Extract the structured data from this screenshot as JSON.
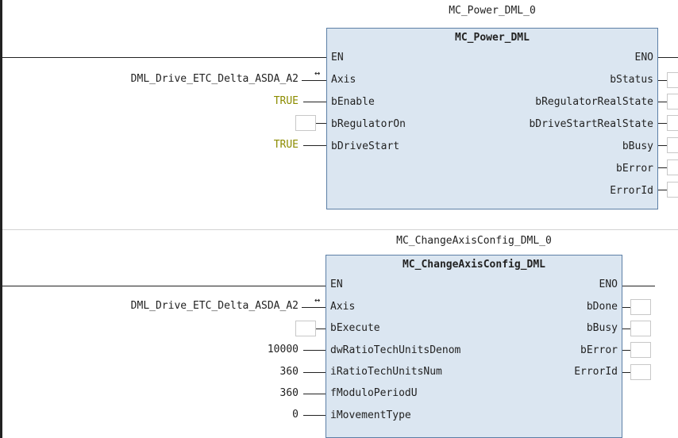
{
  "network1": {
    "instance": "MC_Power_DML_0",
    "type": "MC_Power_DML",
    "inputs": [
      "EN",
      "Axis",
      "bEnable",
      "bRegulatorOn",
      "bDriveStart"
    ],
    "outputs": [
      "ENO",
      "bStatus",
      "bRegulatorRealState",
      "bDriveStartRealState",
      "bBusy",
      "bError",
      "ErrorId"
    ],
    "axis_var": "DML_Drive_ETC_Delta_ASDA_A2",
    "enable_value": "TRUE",
    "drivestart_value": "TRUE"
  },
  "network2": {
    "instance": "MC_ChangeAxisConfig_DML_0",
    "type": "MC_ChangeAxisConfig_DML",
    "inputs": [
      "EN",
      "Axis",
      "bExecute",
      "dwRatioTechUnitsDenom",
      "iRatioTechUnitsNum",
      "fModuloPeriodU",
      "iMovementType"
    ],
    "outputs": [
      "ENO",
      "bDone",
      "bBusy",
      "bError",
      "ErrorId"
    ],
    "axis_var": "DML_Drive_ETC_Delta_ASDA_A2",
    "denom_value": "10000",
    "num_value": "360",
    "modulo_value": "360",
    "movement_value": "0"
  },
  "inout_symbol": "↔"
}
